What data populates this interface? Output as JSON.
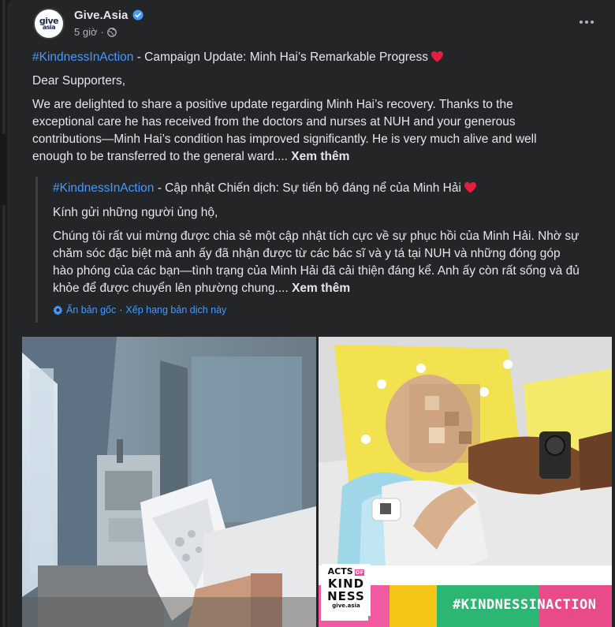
{
  "post": {
    "page_name": "Give.Asia",
    "time_ago": "5 giờ",
    "avatar_text": "give",
    "avatar_subtext": "asia"
  },
  "original": {
    "hashtag": "#KindnessInAction",
    "title_rest": " -  Campaign Update: Minh Hai’s Remarkable Progress",
    "greeting": "Dear Supporters,",
    "body": "We are delighted to share a positive update regarding Minh Hai’s recovery. Thanks to the exceptional care he has received from the doctors and nurses at NUH and your generous contributions—Minh Hai’s condition has improved significantly. He is very much alive and well enough to be transferred to the general ward.... ",
    "see_more": "Xem thêm"
  },
  "translation": {
    "hashtag": "#KindnessInAction",
    "title_rest": " - Cập nhật Chiến dịch: Sự tiến bộ đáng nể của Minh Hải",
    "greeting": "Kính gửi những người ủng hộ,",
    "body": "Chúng tôi rất vui mừng được chia sẻ một cập nhật tích cực về sự phục hồi của Minh Hải. Nhờ sự chăm sóc đặc biệt mà anh ấy đã nhận được từ các bác sĩ và y tá tại NUH và những đóng góp hào phóng của các bạn—tình trạng của Minh Hải đã cải thiện đáng kể. Anh ấy còn rất sống và đủ khỏe để được chuyển lên phường chung.... ",
    "see_more": "Xem thêm",
    "hide_original": "Ẩn bản gốc",
    "separator": "·",
    "rate_translation": "Xếp hạng bản dịch này"
  },
  "banner": {
    "acts_of": "ACTS",
    "of": "OF",
    "kind": "KIND",
    "ness": "NESS",
    "brand": "give.asia",
    "hashtag": "#KINDNESSINACTION"
  },
  "colors": {
    "accent": "#4599ff",
    "background": "#242526",
    "text": "#e4e6eb",
    "muted": "#b0b3b8",
    "heart": "#e41e3f"
  },
  "icons": {
    "verified": "verified-badge-icon",
    "globe": "globe-icon",
    "more": "more-options-icon",
    "gear": "gear-icon"
  }
}
